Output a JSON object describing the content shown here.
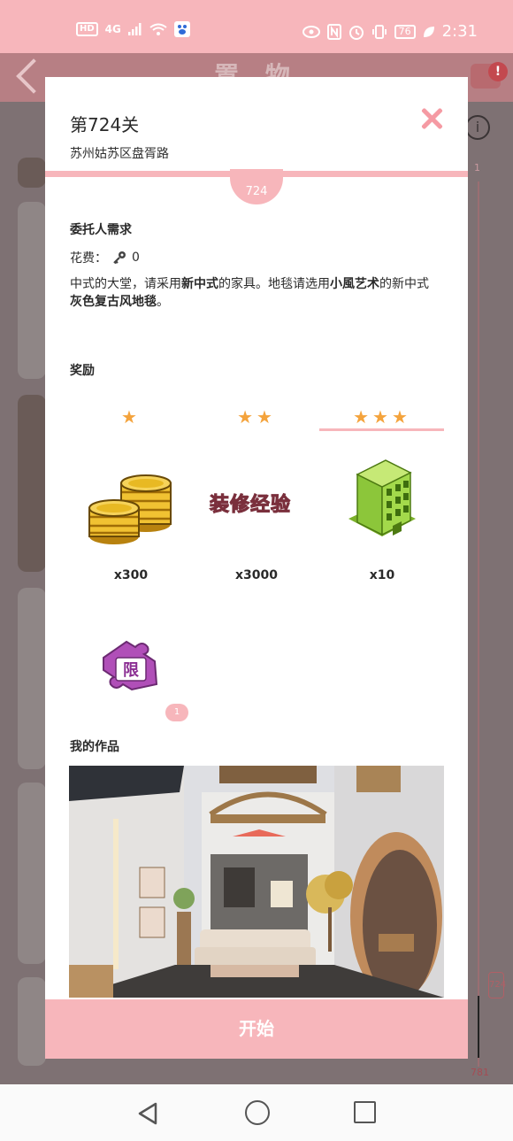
{
  "status_bar": {
    "hd": "HD",
    "network": "4G",
    "battery": "76",
    "time": "2:31"
  },
  "background_app": {
    "title": "置 物",
    "notification_dot": "!",
    "slider_top_value": "1",
    "slider_bottom_value": "781",
    "slider_knob_value": "724"
  },
  "modal": {
    "title": "第724关",
    "subtitle": "苏州姑苏区盘胥路",
    "level_number": "724",
    "client_section": {
      "heading": "委托人需求",
      "cost_label": "花费：",
      "cost_value": "0",
      "description_parts": [
        {
          "text": "中式的大堂，请采用",
          "bold": false
        },
        {
          "text": "新中式",
          "bold": true
        },
        {
          "text": "的家具。地毯请选用",
          "bold": false
        },
        {
          "text": "小風艺术",
          "bold": true
        },
        {
          "text": "的新中式",
          "bold": false
        },
        {
          "text": "灰色复古风地毯",
          "bold": true
        },
        {
          "text": "。",
          "bold": false
        }
      ]
    },
    "rewards_section": {
      "heading": "奖励",
      "tiers": [
        {
          "stars": "★",
          "selected": false
        },
        {
          "stars": "★★",
          "selected": false
        },
        {
          "stars": "★★★",
          "selected": true
        }
      ],
      "items": [
        {
          "icon": "coins-icon",
          "quantity": "x300"
        },
        {
          "icon": "decoration-exp-icon",
          "label": "装修经验",
          "quantity": "x3000"
        },
        {
          "icon": "building-icon",
          "quantity": "x10"
        }
      ],
      "limited_piece": {
        "icon": "limited-puzzle-icon",
        "label": "限",
        "badge": "1"
      }
    },
    "works_section": {
      "heading": "我的作品"
    },
    "start_button": "开始"
  },
  "colors": {
    "accent_pink": "#f7b6bb",
    "close_pink": "#f59aa3",
    "star_orange": "#f4a33c"
  }
}
